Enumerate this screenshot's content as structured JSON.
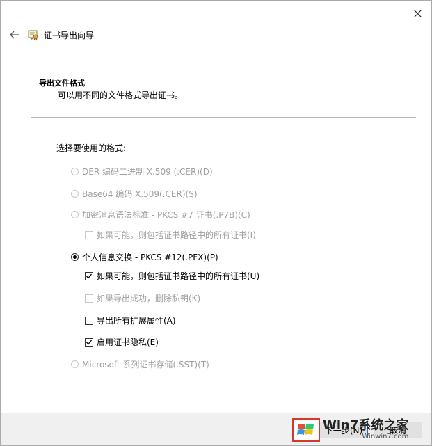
{
  "window": {
    "title": "证书导出向导"
  },
  "section": {
    "heading": "导出文件格式",
    "description": "可以用不同的文件格式导出证书。"
  },
  "formats": {
    "label": "选择要使用的格式:",
    "der": {
      "label": "DER 编码二进制 X.509 (.CER)(D)",
      "selected": false,
      "enabled": false
    },
    "base64": {
      "label": "Base64 编码 X.509(.CER)(S)",
      "selected": false,
      "enabled": false
    },
    "pkcs7": {
      "label": "加密消息语法标准 - PKCS #7 证书(.P7B)(C)",
      "selected": false,
      "enabled": false,
      "include_all": {
        "label": "如果可能，则包括证书路径中的所有证书(I)",
        "checked": false,
        "enabled": false
      }
    },
    "pkcs12": {
      "label": "个人信息交换 - PKCS #12(.PFX)(P)",
      "selected": true,
      "enabled": true,
      "include_all": {
        "label": "如果可能，则包括证书路径中的所有证书(U)",
        "checked": true,
        "enabled": true
      },
      "delete_key": {
        "label": "如果导出成功，删除私钥(K)",
        "checked": false,
        "enabled": false
      },
      "export_ext": {
        "label": "导出所有扩展属性(A)",
        "checked": false,
        "enabled": true
      },
      "privacy": {
        "label": "启用证书隐私(E)",
        "checked": true,
        "enabled": true
      }
    },
    "sst": {
      "label": "Microsoft 系列证书存储(.SST)(T)",
      "selected": false,
      "enabled": false
    }
  },
  "footer": {
    "next_label": "下一步(N)",
    "cancel_label": "取消"
  },
  "watermark": {
    "brand_cn": "Win7系统之家",
    "url": "Winwin7.com"
  },
  "colors": {
    "accent": "#0078d7",
    "disabled_text": "#a0a0a0",
    "divider": "#b8b8b8",
    "footer_bg": "#f0f0f0",
    "watermark_red": "#d23a2b"
  }
}
